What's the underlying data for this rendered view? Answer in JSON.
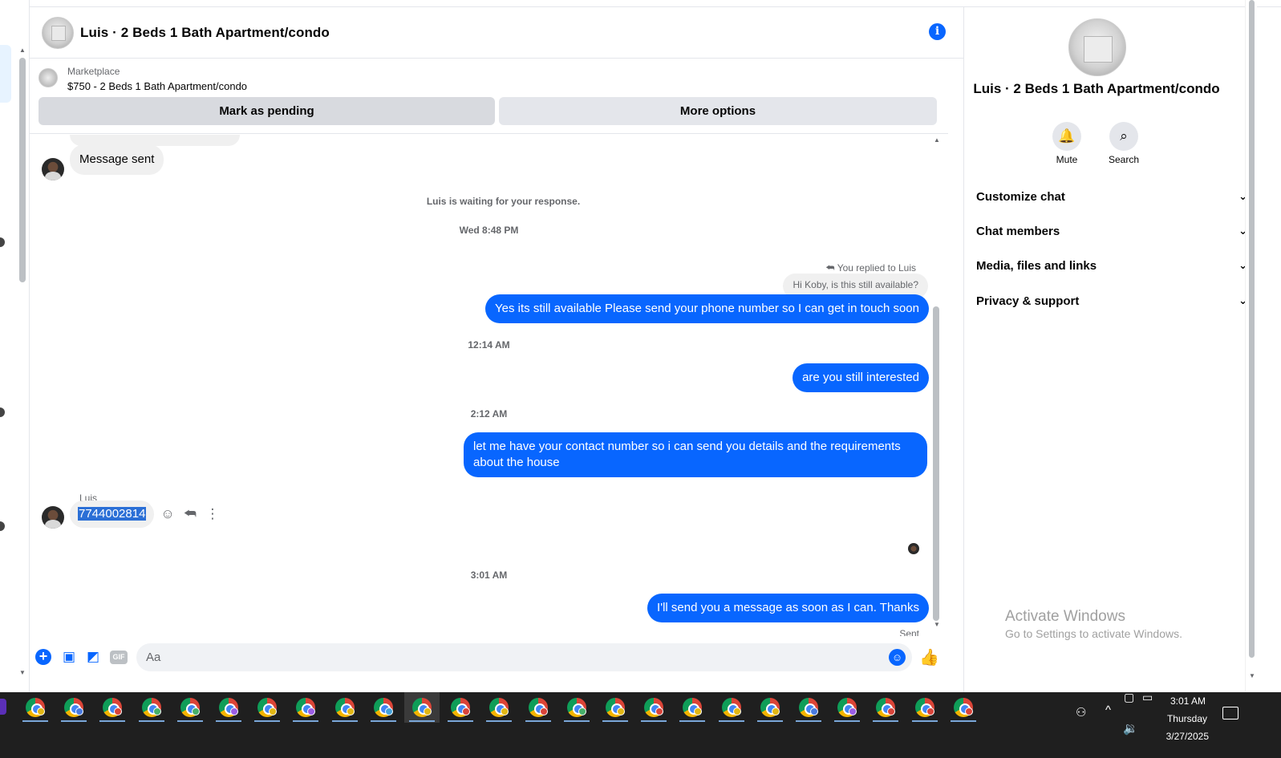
{
  "chat": {
    "title": "Luis · 2 Beds 1 Bath Apartment/condo",
    "info_icon": "info-icon"
  },
  "marketplace": {
    "label": "Marketplace",
    "listing": "$750 - 2 Beds 1 Bath Apartment/condo",
    "pending_button": "Mark as pending",
    "more_button": "More options"
  },
  "messages": {
    "message_sent": "Message sent",
    "waiting": "Luis is waiting for your response.",
    "ts1": "Wed 8:48 PM",
    "reply_note": "You replied to Luis",
    "quoted": "Hi Koby, is this still available?",
    "out1": "Yes its still available Please send your phone number so I can get in touch soon",
    "ts2": "12:14 AM",
    "out2": "are you still interested",
    "ts3": "2:12 AM",
    "out3": "let me have your contact number so i can send you details and the requirements about the house",
    "sender": "Luis",
    "in_number": "7744002814",
    "ts4": "3:01 AM",
    "out4": "I'll send you a message as soon as I can. Thanks",
    "sent_status": "Sent"
  },
  "composer": {
    "placeholder": "Aa",
    "gif_label": "GIF"
  },
  "details": {
    "title": "Luis · 2 Beds 1 Bath Apartment/condo",
    "mute_label": "Mute",
    "search_label": "Search",
    "sections": [
      "Customize chat",
      "Chat members",
      "Media, files and links",
      "Privacy & support"
    ]
  },
  "watermark": {
    "line1": "Activate Windows",
    "line2": "Go to Settings to activate Windows."
  },
  "taskbar": {
    "time": "3:01 AM",
    "day": "Thursday",
    "date": "3/27/2025",
    "badge_colors": [
      "#e2b714",
      "#4a7be0",
      "#d9443a",
      "#47b06a",
      "#47b06a",
      "#9b5de5",
      "#e2b714",
      "#9b5de5",
      "#e2b714",
      "#46a2d9",
      "#e2b714",
      "#d9443a",
      "#e2b714",
      "#d9443a",
      "#47b06a",
      "#e2b714",
      "#d9443a",
      "#e2b714",
      "#e2b714",
      "#e2b714",
      "#4a7be0",
      "#9b5de5",
      "#d9443a",
      "#d9443a",
      "#d9443a"
    ]
  },
  "colors": {
    "accent": "#0866ff",
    "bubble_in": "#f0f0f0"
  }
}
